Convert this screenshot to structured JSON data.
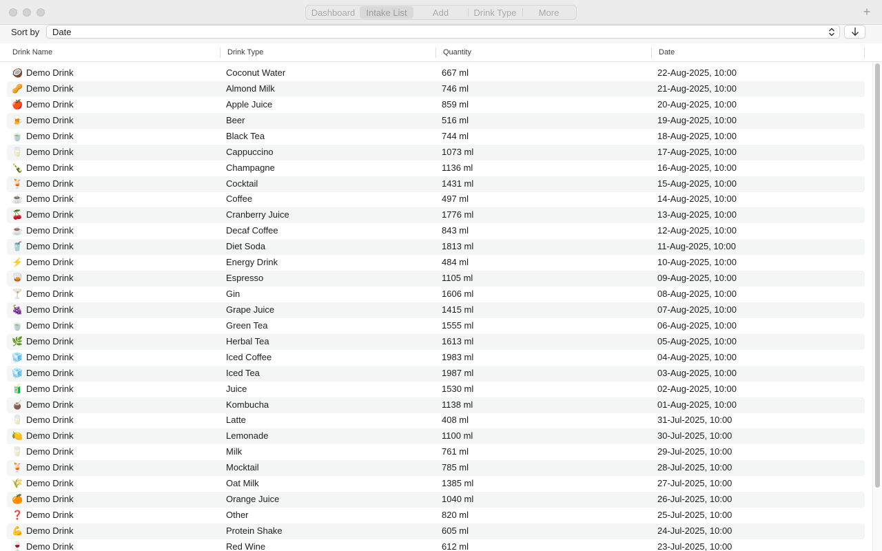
{
  "toolbar": {
    "tabs": [
      "Dashboard",
      "Intake List",
      "Add",
      "Drink Type",
      "More"
    ],
    "active_tab": "Intake List",
    "add_label": "+"
  },
  "sort": {
    "label": "Sort by",
    "selected": "Date",
    "direction_icon": "arrow-down-icon"
  },
  "table": {
    "columns": [
      "Drink Name",
      "Drink Type",
      "Quantity",
      "Date"
    ],
    "rows": [
      {
        "icon": "🥥",
        "name": "Demo Drink",
        "type": "Coconut Water",
        "quantity": "667 ml",
        "date": "22-Aug-2025, 10:00"
      },
      {
        "icon": "🥜",
        "name": "Demo Drink",
        "type": "Almond Milk",
        "quantity": "746 ml",
        "date": "21-Aug-2025, 10:00"
      },
      {
        "icon": "🍎",
        "name": "Demo Drink",
        "type": "Apple Juice",
        "quantity": "859 ml",
        "date": "20-Aug-2025, 10:00"
      },
      {
        "icon": "🍺",
        "name": "Demo Drink",
        "type": "Beer",
        "quantity": "516 ml",
        "date": "19-Aug-2025, 10:00"
      },
      {
        "icon": "🍵",
        "name": "Demo Drink",
        "type": "Black Tea",
        "quantity": "744 ml",
        "date": "18-Aug-2025, 10:00"
      },
      {
        "icon": "🥛",
        "name": "Demo Drink",
        "type": "Cappuccino",
        "quantity": "1073 ml",
        "date": "17-Aug-2025, 10:00"
      },
      {
        "icon": "🍾",
        "name": "Demo Drink",
        "type": "Champagne",
        "quantity": "1136 ml",
        "date": "16-Aug-2025, 10:00"
      },
      {
        "icon": "🍹",
        "name": "Demo Drink",
        "type": "Cocktail",
        "quantity": "1431 ml",
        "date": "15-Aug-2025, 10:00"
      },
      {
        "icon": "☕",
        "name": "Demo Drink",
        "type": "Coffee",
        "quantity": "497 ml",
        "date": "14-Aug-2025, 10:00"
      },
      {
        "icon": "🍒",
        "name": "Demo Drink",
        "type": "Cranberry Juice",
        "quantity": "1776 ml",
        "date": "13-Aug-2025, 10:00"
      },
      {
        "icon": "☕",
        "name": "Demo Drink",
        "type": "Decaf Coffee",
        "quantity": "843 ml",
        "date": "12-Aug-2025, 10:00"
      },
      {
        "icon": "🥤",
        "name": "Demo Drink",
        "type": "Diet Soda",
        "quantity": "1813 ml",
        "date": "11-Aug-2025, 10:00"
      },
      {
        "icon": "⚡",
        "name": "Demo Drink",
        "type": "Energy Drink",
        "quantity": "484 ml",
        "date": "10-Aug-2025, 10:00"
      },
      {
        "icon": "🥃",
        "name": "Demo Drink",
        "type": "Espresso",
        "quantity": "1105 ml",
        "date": "09-Aug-2025, 10:00"
      },
      {
        "icon": "🍸",
        "name": "Demo Drink",
        "type": "Gin",
        "quantity": "1606 ml",
        "date": "08-Aug-2025, 10:00"
      },
      {
        "icon": "🍇",
        "name": "Demo Drink",
        "type": "Grape Juice",
        "quantity": "1415 ml",
        "date": "07-Aug-2025, 10:00"
      },
      {
        "icon": "🍵",
        "name": "Demo Drink",
        "type": "Green Tea",
        "quantity": "1555 ml",
        "date": "06-Aug-2025, 10:00"
      },
      {
        "icon": "🌿",
        "name": "Demo Drink",
        "type": "Herbal Tea",
        "quantity": "1613 ml",
        "date": "05-Aug-2025, 10:00"
      },
      {
        "icon": "🧊",
        "name": "Demo Drink",
        "type": "Iced Coffee",
        "quantity": "1983 ml",
        "date": "04-Aug-2025, 10:00"
      },
      {
        "icon": "🧊",
        "name": "Demo Drink",
        "type": "Iced Tea",
        "quantity": "1987 ml",
        "date": "03-Aug-2025, 10:00"
      },
      {
        "icon": "🧃",
        "name": "Demo Drink",
        "type": "Juice",
        "quantity": "1530 ml",
        "date": "02-Aug-2025, 10:00"
      },
      {
        "icon": "🧉",
        "name": "Demo Drink",
        "type": "Kombucha",
        "quantity": "1138 ml",
        "date": "01-Aug-2025, 10:00"
      },
      {
        "icon": "🥛",
        "name": "Demo Drink",
        "type": "Latte",
        "quantity": "408 ml",
        "date": "31-Jul-2025, 10:00"
      },
      {
        "icon": "🍋",
        "name": "Demo Drink",
        "type": "Lemonade",
        "quantity": "1100 ml",
        "date": "30-Jul-2025, 10:00"
      },
      {
        "icon": "🥛",
        "name": "Demo Drink",
        "type": "Milk",
        "quantity": "761 ml",
        "date": "29-Jul-2025, 10:00"
      },
      {
        "icon": "🍹",
        "name": "Demo Drink",
        "type": "Mocktail",
        "quantity": "785 ml",
        "date": "28-Jul-2025, 10:00"
      },
      {
        "icon": "🌾",
        "name": "Demo Drink",
        "type": "Oat Milk",
        "quantity": "1385 ml",
        "date": "27-Jul-2025, 10:00"
      },
      {
        "icon": "🍊",
        "name": "Demo Drink",
        "type": "Orange Juice",
        "quantity": "1040 ml",
        "date": "26-Jul-2025, 10:00"
      },
      {
        "icon": "❓",
        "name": "Demo Drink",
        "type": "Other",
        "quantity": "820 ml",
        "date": "25-Jul-2025, 10:00"
      },
      {
        "icon": "💪",
        "name": "Demo Drink",
        "type": "Protein Shake",
        "quantity": "605 ml",
        "date": "24-Jul-2025, 10:00"
      },
      {
        "icon": "🍷",
        "name": "Demo Drink",
        "type": "Red Wine",
        "quantity": "612 ml",
        "date": "23-Jul-2025, 10:00"
      }
    ]
  }
}
